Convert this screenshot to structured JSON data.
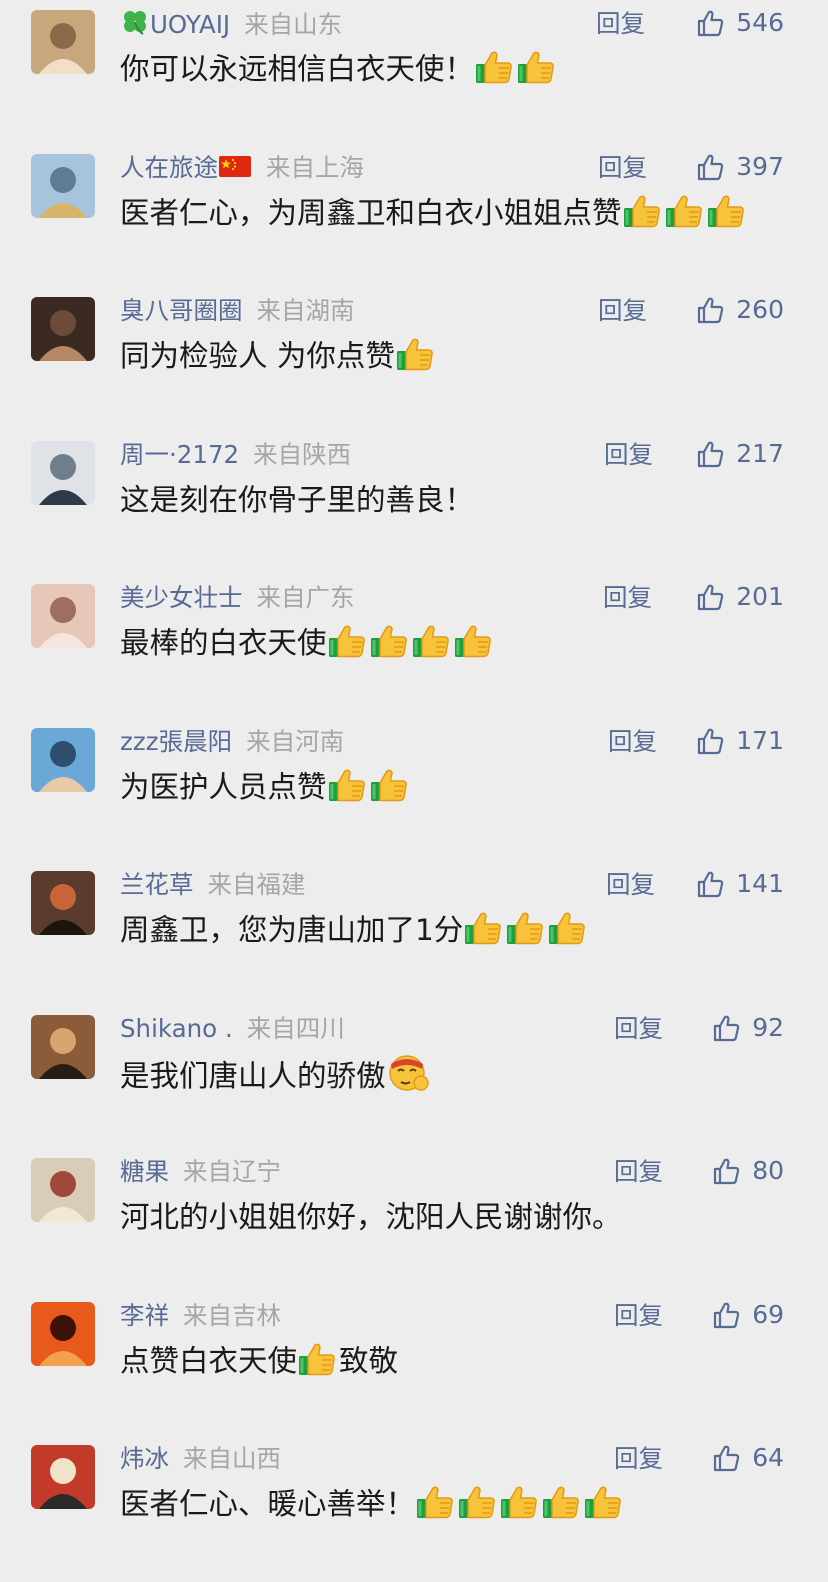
{
  "comments": [
    {
      "nickname": "UOYAIJ",
      "nick_icon": "four-leaf-clover-icon",
      "region": "来自山东",
      "reply": "回复",
      "likes": "546",
      "text": "你可以永远相信白衣天使！",
      "emoji": [
        "thumbs-up-icon",
        "thumbs-up-icon"
      ]
    },
    {
      "nickname": "人在旅途",
      "nick_icon": "china-flag-icon",
      "region": "来自上海",
      "reply": "回复",
      "likes": "397",
      "text": "医者仁心，为周鑫卫和白衣小姐姐点赞",
      "emoji": [
        "thumbs-up-icon",
        "thumbs-up-icon",
        "thumbs-up-icon"
      ]
    },
    {
      "nickname": "臭八哥圈圈",
      "region": "来自湖南",
      "reply": "回复",
      "likes": "260",
      "text": "同为检验人 为你点赞",
      "emoji": [
        "thumbs-up-icon"
      ]
    },
    {
      "nickname": "周一·2172",
      "region": "来自陕西",
      "reply": "回复",
      "likes": "217",
      "text": "这是刻在你骨子里的善良！",
      "emoji": []
    },
    {
      "nickname": "美少女壮士",
      "region": "来自广东",
      "reply": "回复",
      "likes": "201",
      "text": "最棒的白衣天使",
      "emoji": [
        "thumbs-up-icon",
        "thumbs-up-icon",
        "thumbs-up-icon",
        "thumbs-up-icon"
      ]
    },
    {
      "nickname": "zzz張晨阳",
      "region": "来自河南",
      "reply": "回复",
      "likes": "171",
      "text": "为医护人员点赞",
      "emoji": [
        "thumbs-up-icon",
        "thumbs-up-icon"
      ]
    },
    {
      "nickname": "兰花草",
      "region": "来自福建",
      "reply": "回复",
      "likes": "141",
      "text": "周鑫卫，您为唐山加了1分",
      "emoji": [
        "thumbs-up-icon",
        "thumbs-up-icon",
        "thumbs-up-icon"
      ]
    },
    {
      "nickname": "Shikano .",
      "region": "来自四川",
      "reply": "回复",
      "likes": "92",
      "text": "是我们唐山人的骄傲",
      "emoji": [
        "proud-face-icon"
      ]
    },
    {
      "nickname": "糖果",
      "region": "来自辽宁",
      "reply": "回复",
      "likes": "80",
      "text": "河北的小姐姐你好，沈阳人民谢谢你。",
      "emoji": []
    },
    {
      "nickname": "李祥",
      "region": "来自吉林",
      "reply": "回复",
      "likes": "69",
      "text": "点赞白衣天使",
      "emoji": [
        "thumbs-up-icon"
      ],
      "text_after": "致敬"
    },
    {
      "nickname": "炜冰",
      "region": "来自山西",
      "reply": "回复",
      "likes": "64",
      "text": "医者仁心、暖心善举！",
      "emoji": [
        "thumbs-up-icon",
        "thumbs-up-icon",
        "thumbs-up-icon",
        "thumbs-up-icon",
        "thumbs-up-icon"
      ]
    }
  ]
}
